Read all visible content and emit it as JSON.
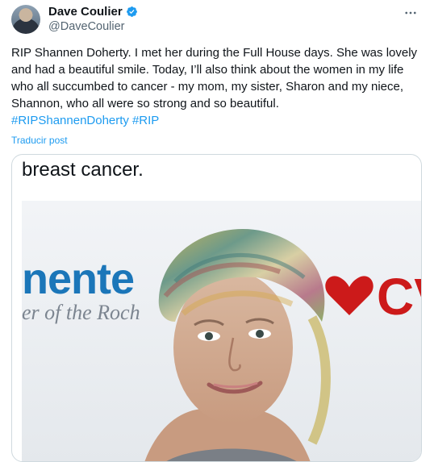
{
  "author": {
    "display_name": "Dave Coulier",
    "handle": "@DaveCoulier",
    "verified": true
  },
  "tweet": {
    "text": "RIP Shannen Doherty. I met her during the Full House days. She was lovely and had a beautiful smile. Today, I’ll also think about the women in my life who all succumbed to cancer - my mom, my sister, Sharon and my niece, Shannon, who all were so strong and so beautiful.",
    "hashtags": [
      "#RIPShannenDoherty",
      "#RIP"
    ],
    "translate_label": "Traducir post"
  },
  "media": {
    "caption": "breast cancer.",
    "backdrop_word": "nente",
    "backdrop_sub": "er of the Roch",
    "backdrop_logo": "CV"
  },
  "colors": {
    "link": "#1d9bf0",
    "verified": "#1d9bf0",
    "backdrop_blue": "#1b76b9",
    "backdrop_red": "#cc1a1a"
  },
  "icons": {
    "verified": "verified-badge-icon",
    "more": "more-options-icon"
  }
}
